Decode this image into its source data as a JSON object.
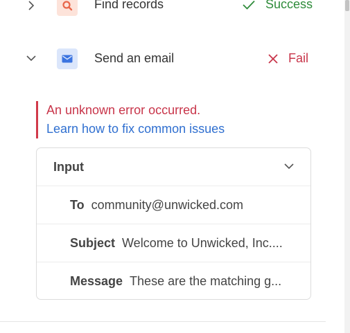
{
  "steps": [
    {
      "title": "Find records",
      "status": "Success",
      "status_color": "#2e8b3a",
      "icon": "search-icon",
      "icon_bg": "#fde3da",
      "icon_color": "#e8664a",
      "expanded": false
    },
    {
      "title": "Send an email",
      "status": "Fail",
      "status_color": "#c8354a",
      "icon": "envelope-icon",
      "icon_bg": "#dbe6fb",
      "icon_color": "#3b74e0",
      "expanded": true
    }
  ],
  "error": {
    "message": "An unknown error occurred.",
    "link": "Learn how to fix common issues"
  },
  "input_panel": {
    "title": "Input",
    "fields": [
      {
        "label": "To",
        "value": "community@unwicked.com"
      },
      {
        "label": "Subject",
        "value": "Welcome to Unwicked, Inc...."
      },
      {
        "label": "Message",
        "value": "These are the matching g..."
      }
    ]
  }
}
